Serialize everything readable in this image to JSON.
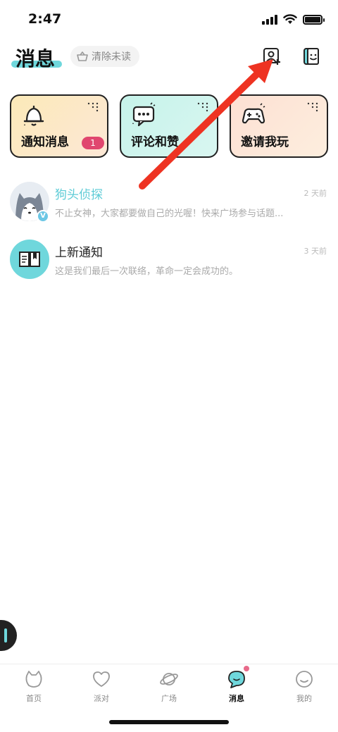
{
  "status": {
    "time": "2:47"
  },
  "header": {
    "title": "消息",
    "clear_unread_label": "清除未读",
    "add_friend_icon": "add-user-icon",
    "contacts_icon": "contacts-icon"
  },
  "cards": [
    {
      "label": "通知消息",
      "icon": "bell-icon",
      "badge": "1"
    },
    {
      "label": "评论和赞",
      "icon": "chat-bubble-icon"
    },
    {
      "label": "邀请我玩",
      "icon": "gamepad-icon"
    }
  ],
  "messages": [
    {
      "name": "狗头侦探",
      "preview": "不止女神，大家都要做自己的光喔！快来广场参与话题...",
      "time": "2 天前"
    },
    {
      "name": "上新通知",
      "preview": "这是我们最后一次联络，革命一定会成功的。",
      "time": "3 天前"
    }
  ],
  "tabs": [
    {
      "label": "首页",
      "icon": "cat-icon"
    },
    {
      "label": "派对",
      "icon": "heart-icon"
    },
    {
      "label": "广场",
      "icon": "planet-icon"
    },
    {
      "label": "消息",
      "icon": "message-icon",
      "active": true
    },
    {
      "label": "我的",
      "icon": "smile-icon"
    }
  ],
  "colors": {
    "accent": "#6fd7dc",
    "badge": "#e0466f",
    "annotation_arrow": "#ee3322"
  }
}
